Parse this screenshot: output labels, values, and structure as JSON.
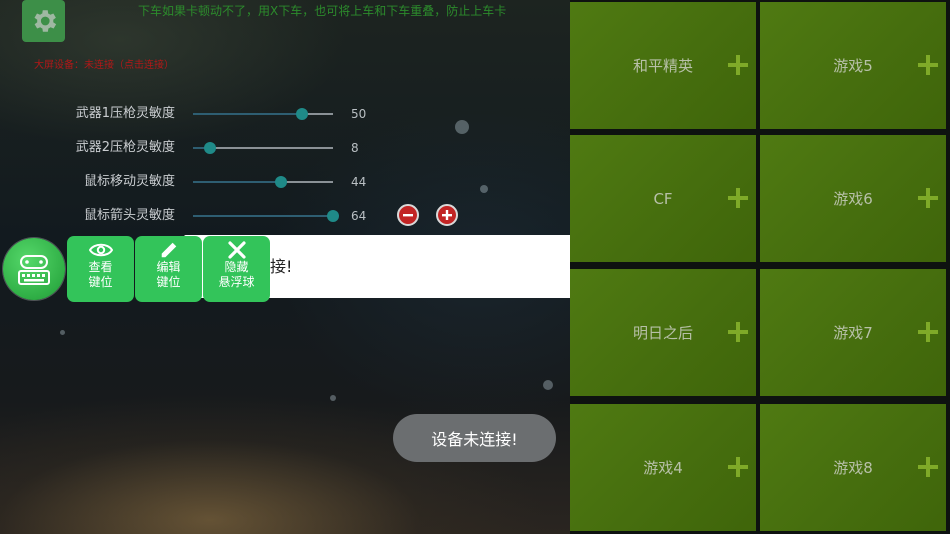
{
  "header": {
    "top_hint": "下车如果卡顿动不了，用X下车，也可将上车和下车重叠，防止上车卡",
    "device_status_hint": "大屏设备：未连接（点击连接）"
  },
  "sliders": [
    {
      "label": "武器1压枪灵敏度",
      "value": "50",
      "fraction": 0.78
    },
    {
      "label": "武器2压枪灵敏度",
      "value": "8",
      "fraction": 0.12
    },
    {
      "label": "鼠标移动灵敏度",
      "value": "44",
      "fraction": 0.63
    },
    {
      "label": "鼠标箭头灵敏度",
      "value": "64",
      "fraction": 1.0
    }
  ],
  "controls": {
    "minus_icon": "minus-icon",
    "plus_icon": "plus-icon"
  },
  "dialog": {
    "message": "连接!"
  },
  "float_menu": {
    "ball_icon": "gamepad-keyboard-icon",
    "actions": [
      {
        "label1": "查看",
        "label2": "键位",
        "icon": "eye-icon"
      },
      {
        "label1": "编辑",
        "label2": "键位",
        "icon": "pencil-icon"
      },
      {
        "label1": "隐藏",
        "label2": "悬浮球",
        "icon": "close-icon"
      }
    ]
  },
  "toast": {
    "message": "设备未连接!"
  },
  "games": [
    {
      "label": "和平精英"
    },
    {
      "label": "游戏5"
    },
    {
      "label": "CF"
    },
    {
      "label": "游戏6"
    },
    {
      "label": "明日之后"
    },
    {
      "label": "游戏7"
    },
    {
      "label": "游戏4"
    },
    {
      "label": "游戏8"
    }
  ],
  "colors": {
    "accent_green": "#33c45a",
    "tile_green": "#4f7a12",
    "hint_green": "#2c8b2c",
    "hint_red": "#b11818",
    "knob": "#1f8a88"
  }
}
